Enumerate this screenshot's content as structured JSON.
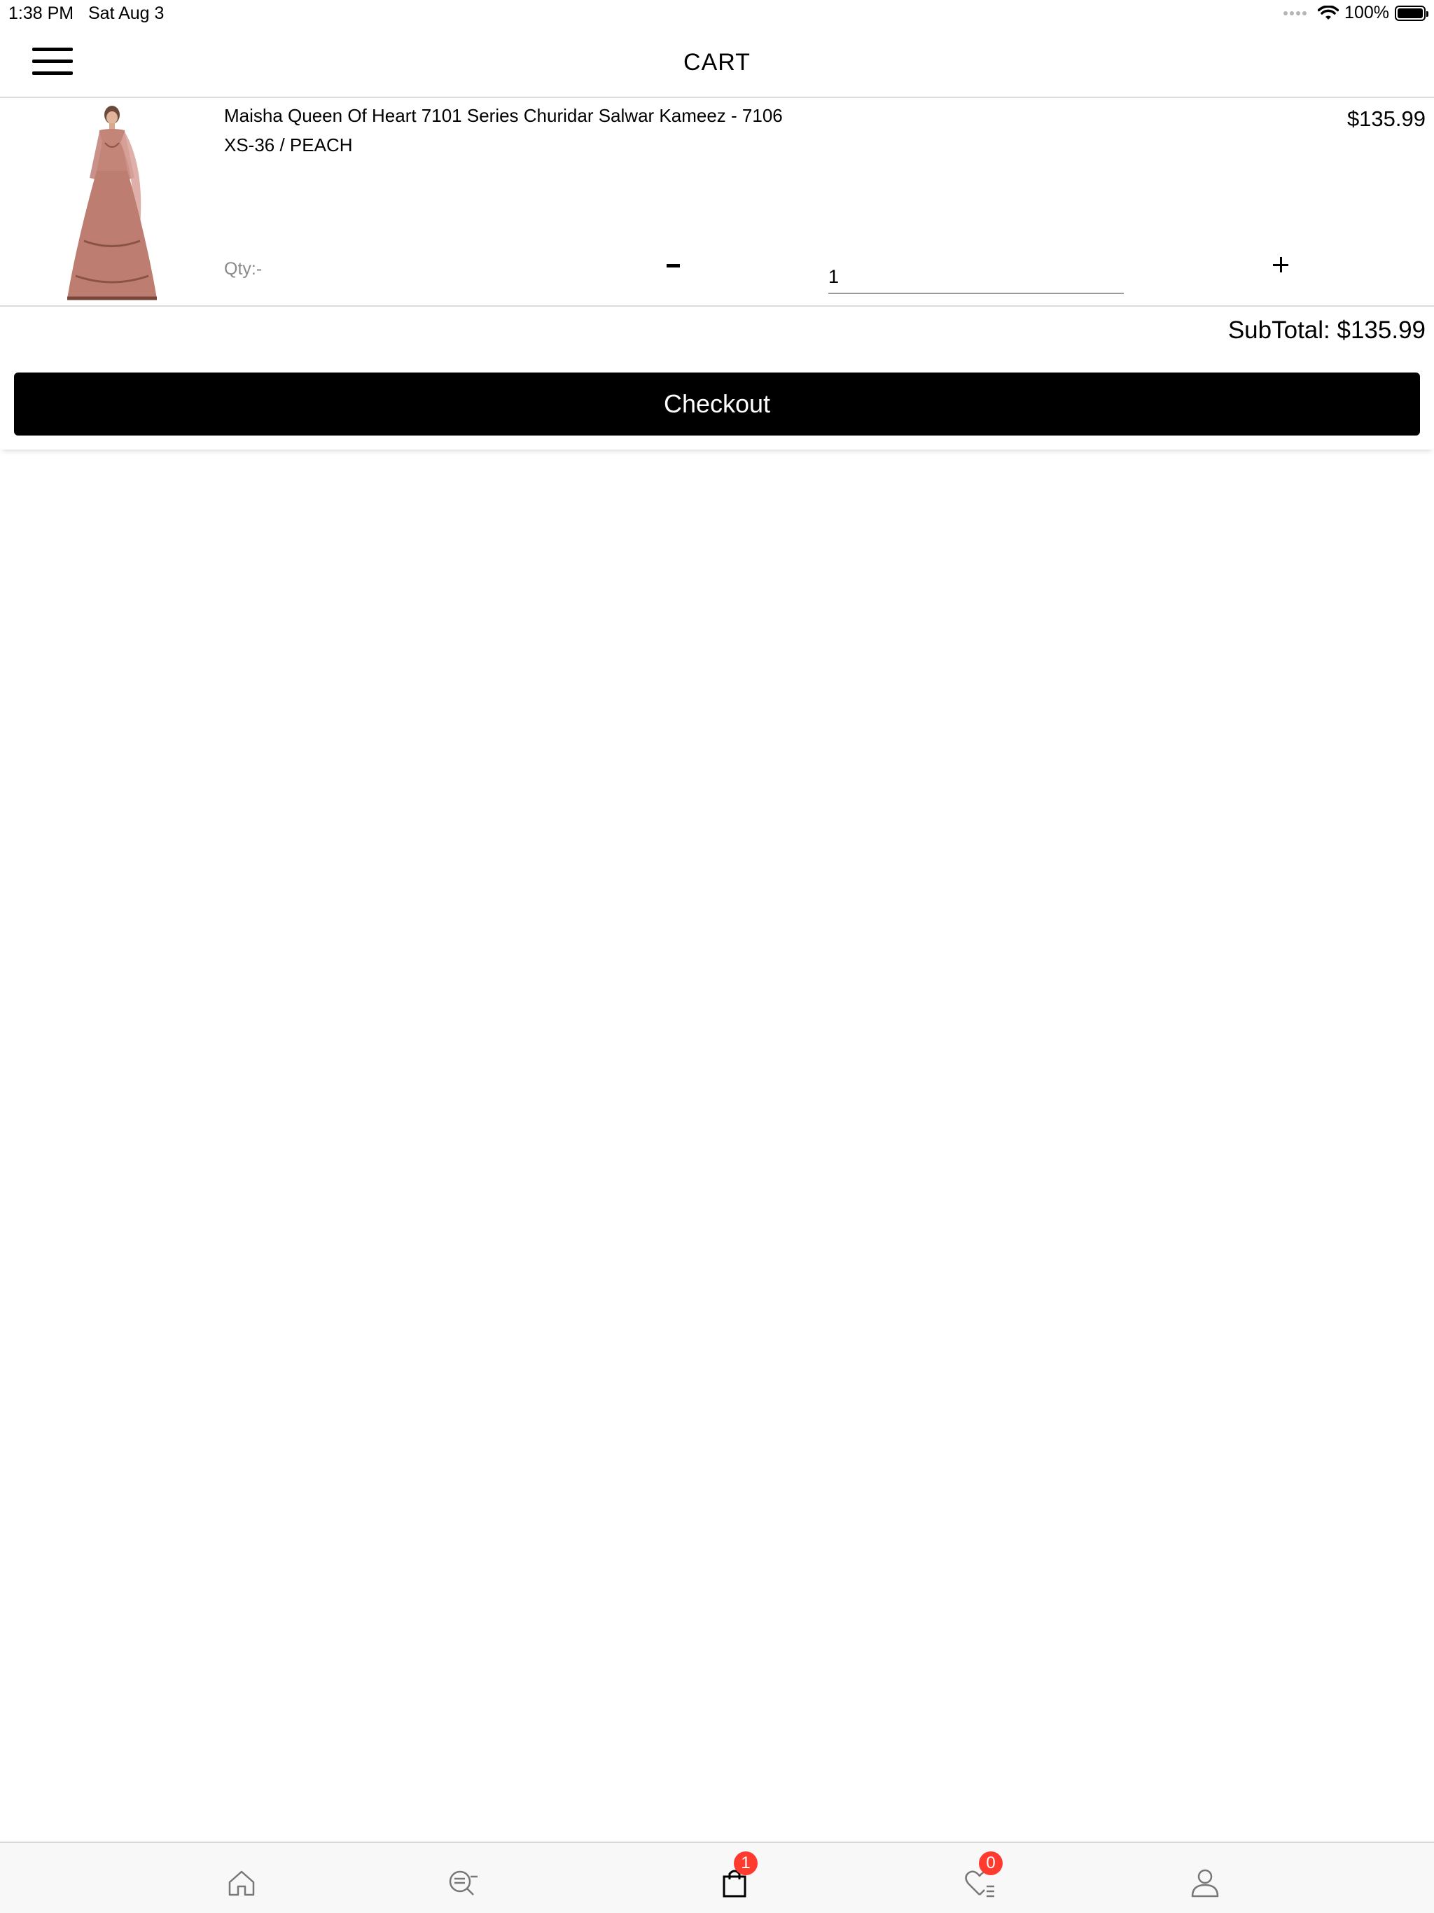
{
  "status_bar": {
    "time": "1:38 PM",
    "date": "Sat Aug 3",
    "battery": "100%"
  },
  "header": {
    "title": "CART",
    "menu_icon": "hamburger-menu-icon"
  },
  "cart_item": {
    "name": "Maisha Queen Of Heart 7101 Series Churidar Salwar Kameez - 7106",
    "variant": "XS-36 / PEACH",
    "price": "$135.99",
    "qty_label": "Qty:-",
    "quantity": "1",
    "image_alt": "Peach embroidered anarkali gown"
  },
  "summary": {
    "subtotal": "SubTotal: $135.99",
    "checkout_label": "Checkout"
  },
  "tabbar": {
    "tabs": [
      {
        "icon": "home-icon"
      },
      {
        "icon": "search-list-icon"
      },
      {
        "icon": "shopping-bag-icon",
        "badge": "1"
      },
      {
        "icon": "wishlist-heart-icon",
        "badge": "0"
      },
      {
        "icon": "profile-icon"
      }
    ]
  },
  "colors": {
    "accent": "#000000",
    "badge": "#ff3b30",
    "product_peach": "#c9897c"
  }
}
